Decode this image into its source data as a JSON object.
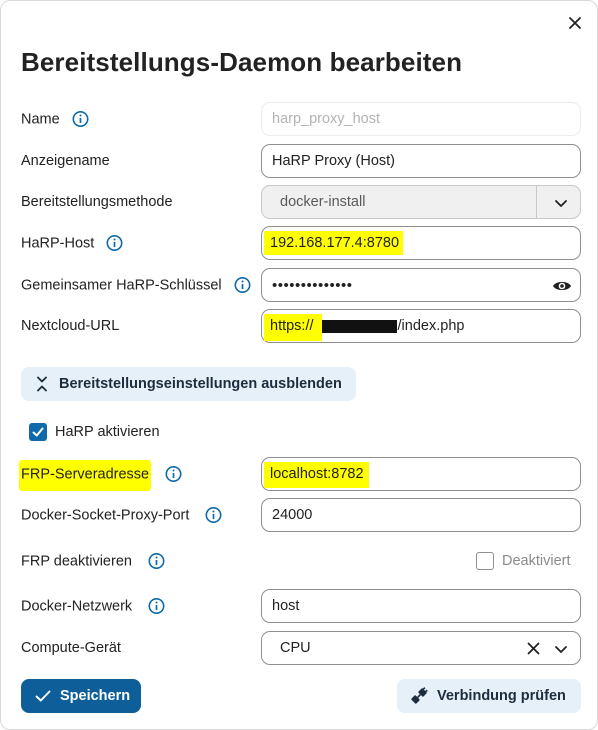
{
  "dialog": {
    "title": "Bereitstellungs-Daemon bearbeiten"
  },
  "fields": {
    "name": {
      "label": "Name",
      "placeholder": "harp_proxy_host"
    },
    "display_name": {
      "label": "Anzeigename",
      "value": "HaRP Proxy (Host)"
    },
    "deploy_method": {
      "label": "Bereitstellungsmethode",
      "value": "docker-install"
    },
    "harp_host": {
      "label": "HaRP-Host",
      "value": "192.168.177.4:8780"
    },
    "harp_key": {
      "label": "Gemeinsamer HaRP-Schlüssel",
      "value": "••••••••••••••"
    },
    "nextcloud_url": {
      "label": "Nextcloud-URL",
      "value_prefix": "https://",
      "value_suffix": "/index.php"
    }
  },
  "toggle_settings_label": "Bereitstellungseinstellungen ausblenden",
  "harp_enable": {
    "label": "HaRP aktivieren",
    "checked": true
  },
  "fields2": {
    "frp_address": {
      "label": "FRP-Serveradresse",
      "value": "localhost:8782"
    },
    "socket_port": {
      "label": "Docker-Socket-Proxy-Port",
      "value": "24000"
    },
    "frp_disable": {
      "label": "FRP deaktivieren",
      "checkbox_label": "Deaktiviert",
      "checked": false
    },
    "network": {
      "label": "Docker-Netzwerk",
      "value": "host"
    },
    "compute": {
      "label": "Compute-Gerät",
      "value": "CPU"
    }
  },
  "buttons": {
    "save": "Speichern",
    "test": "Verbindung prüfen"
  },
  "colors": {
    "primary": "#0e5f99",
    "highlight": "#ffff00",
    "secondary_bg": "#e6f0f8"
  }
}
